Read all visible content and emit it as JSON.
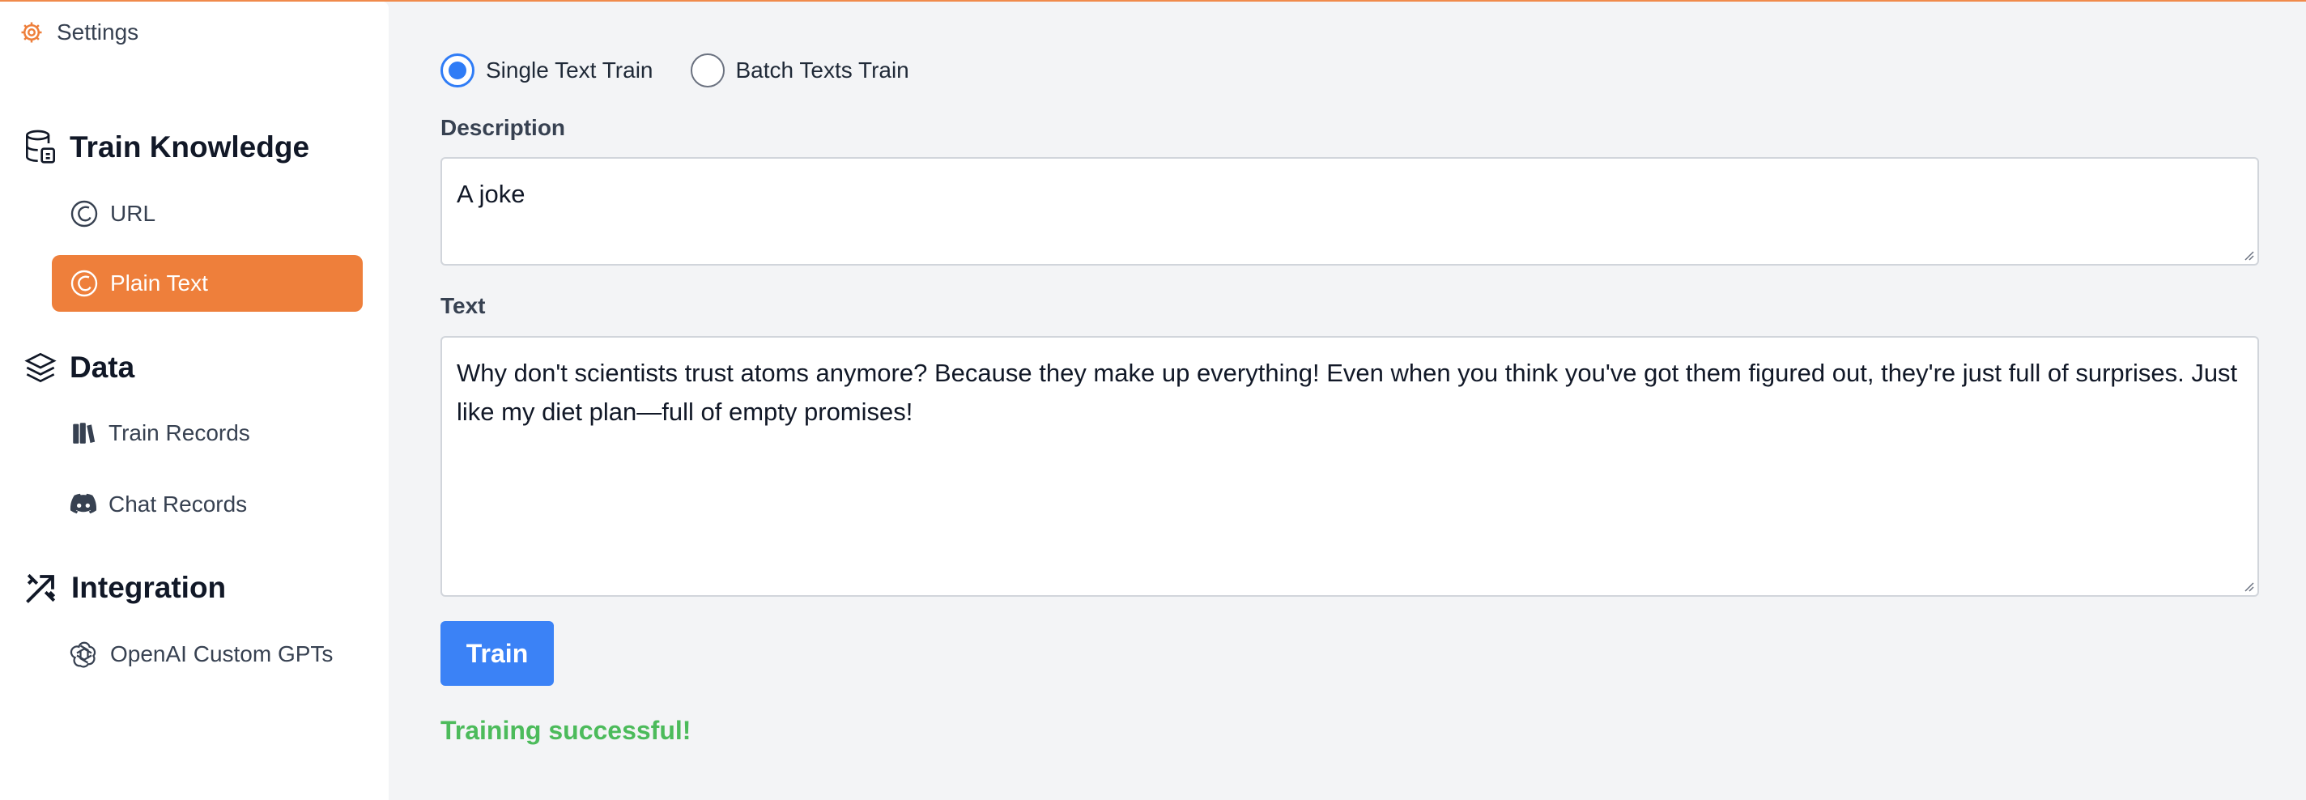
{
  "sidebar": {
    "settings_label": "Settings",
    "sections": {
      "train_knowledge": {
        "title": "Train Knowledge",
        "items": [
          {
            "label": "URL",
            "icon": "elementor-icon",
            "active": false
          },
          {
            "label": "Plain Text",
            "icon": "elementor-icon",
            "active": true
          }
        ]
      },
      "data": {
        "title": "Data",
        "items": [
          {
            "label": "Train Records",
            "icon": "books-icon"
          },
          {
            "label": "Chat Records",
            "icon": "discord-icon"
          }
        ]
      },
      "integration": {
        "title": "Integration",
        "items": [
          {
            "label": "OpenAI Custom GPTs",
            "icon": "openai-icon"
          }
        ]
      }
    }
  },
  "main": {
    "mode_options": [
      {
        "label": "Single Text Train",
        "selected": true
      },
      {
        "label": "Batch Texts Train",
        "selected": false
      }
    ],
    "description_label": "Description",
    "description_value": "A joke",
    "text_label": "Text",
    "text_value": "Why don't scientists trust atoms anymore? Because they make up everything! Even when you think you've got them figured out, they're just full of surprises. Just like my diet plan—full of empty promises!",
    "train_button": "Train",
    "status_message": "Training successful!"
  },
  "colors": {
    "accent_orange": "#ee7f3b",
    "primary_blue": "#3b82f6",
    "success_green": "#4cbb5b"
  }
}
